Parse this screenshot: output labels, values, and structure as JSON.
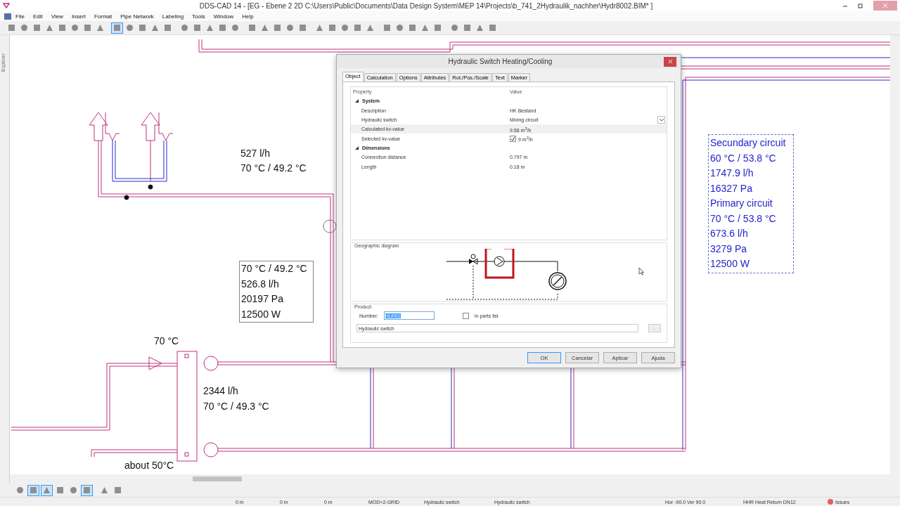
{
  "window": {
    "title": "DDS-CAD 14 - [EG - Ebene 2  2D  C:\\Users\\Public\\Documents\\Data Design System\\MEP 14\\Projects\\b_741_2Hydraulik_nachher\\Hydr8002.BIM* ]"
  },
  "menu": [
    "File",
    "Edit",
    "View",
    "Insert",
    "Format",
    "Pipe Network",
    "Labeling",
    "Tools",
    "Window",
    "Help"
  ],
  "toolbar": [
    {
      "selected": false
    },
    {
      "selected": false
    },
    {
      "selected": false
    },
    {
      "selected": false
    },
    {
      "selected": false
    },
    {
      "selected": false
    },
    {
      "selected": false
    },
    {
      "selected": false
    },
    {
      "selected": true
    },
    {
      "selected": false
    },
    {
      "selected": false
    },
    {
      "selected": false
    },
    {
      "selected": false
    },
    {
      "selected": false
    },
    {
      "selected": false
    },
    {
      "selected": false
    },
    {
      "selected": false
    },
    {
      "selected": false
    },
    {
      "selected": false
    },
    {
      "selected": false
    },
    {
      "selected": false
    },
    {
      "selected": false
    },
    {
      "selected": false
    },
    {
      "selected": false
    },
    {
      "selected": false
    },
    {
      "selected": false
    },
    {
      "selected": false
    },
    {
      "selected": false
    },
    {
      "selected": false
    },
    {
      "selected": false
    },
    {
      "selected": false
    },
    {
      "selected": false
    },
    {
      "selected": false
    },
    {
      "selected": false
    },
    {
      "selected": false
    },
    {
      "selected": false
    },
    {
      "selected": false
    }
  ],
  "side_tab": "Explorer",
  "canvas": {
    "labels": [
      "527 l/h",
      "70 °C / 49.2 °C",
      "70 °C",
      "2344 l/h",
      "70 °C / 49.3 °C",
      "about 50°C"
    ],
    "values_box": [
      "70 °C / 49.2 °C",
      "526.8 l/h",
      "20197 Pa",
      "12500 W"
    ],
    "circuit_box": [
      "Secundary circuit",
      "60 °C / 53.8 °C",
      "1747.9 l/h",
      "16327 Pa",
      "Primary circuit",
      "70 °C / 53.8 °C",
      "673.6 l/h",
      "3279 Pa",
      "12500 W"
    ]
  },
  "dialog": {
    "title": "Hydraulic Switch Heating/Cooling",
    "tabs": [
      {
        "label": "Object",
        "selected": true
      },
      {
        "label": "Calculation",
        "selected": false
      },
      {
        "label": "Options",
        "selected": false
      },
      {
        "label": "Attributes",
        "selected": false
      },
      {
        "label": "Rot./Pos./Scale",
        "selected": false
      },
      {
        "label": "Text",
        "selected": false
      },
      {
        "label": "Marker",
        "selected": false
      }
    ],
    "columns": [
      "Property",
      "Value"
    ],
    "groups": [
      {
        "name": "System",
        "expanded": true,
        "rows": [
          {
            "property": "Description",
            "value": "HK Bestand",
            "kind": "text",
            "selected": false
          },
          {
            "property": "Hydraulic switch",
            "value": "Mixing circuit",
            "kind": "dropdown",
            "selected": false
          },
          {
            "property": "Calculated kv-value",
            "value": "9.58 m$^{3}$/h",
            "kind": "text",
            "selected": true
          },
          {
            "property": "Selected kv-value",
            "value": "9 m$^{3}$/h",
            "kind": "checkbox",
            "checked": true,
            "selected": false
          }
        ]
      },
      {
        "name": "Dimensions",
        "expanded": true,
        "rows": [
          {
            "property": "Connection distance",
            "value": "0.797 m",
            "kind": "text",
            "selected": false
          },
          {
            "property": "Length",
            "value": "0.18 m",
            "kind": "text",
            "selected": false
          }
        ]
      }
    ],
    "diagram_label": "Geographic diagram",
    "product": {
      "label": "Product",
      "number_label": "Number:",
      "number": "HU001",
      "in_parts_list": {
        "label": "In parts list",
        "checked": false
      },
      "description": "Hydraulic switch",
      "browse": "..."
    },
    "buttons": [
      {
        "label": "OK",
        "default": true
      },
      {
        "label": "Cancelar",
        "default": false
      },
      {
        "label": "Aplicar",
        "default": false
      },
      {
        "label": "Ajuda",
        "default": false
      }
    ]
  },
  "bottom_tools": [
    {
      "selected": false
    },
    {
      "selected": true
    },
    {
      "selected": true
    },
    {
      "selected": false
    },
    {
      "selected": false
    },
    {
      "selected": true
    },
    {
      "selected": false
    },
    {
      "selected": false
    }
  ],
  "status_bar": [
    "0 m",
    "0 m",
    "0 m",
    "MOD=2-GRID",
    "Hydraulic switch",
    "Hydraulic switch",
    "Hor -90.0 Ver  90.0",
    "HHR Heat Return DN12",
    "Issues"
  ]
}
